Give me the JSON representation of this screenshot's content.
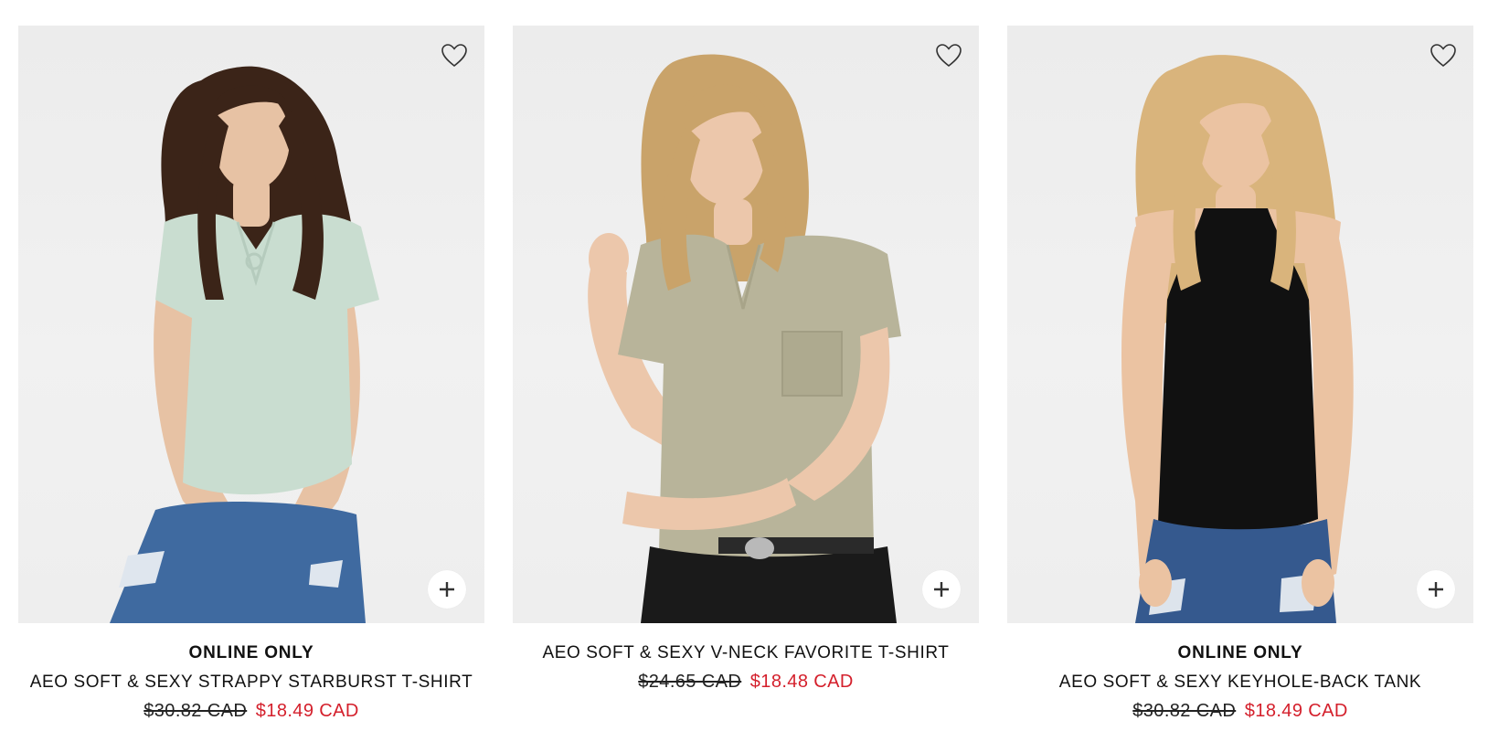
{
  "products": [
    {
      "badge": "ONLINE ONLY",
      "name": "AEO SOFT & SEXY STRAPPY STARBURST T-SHIRT",
      "old_price": "$30.82 CAD",
      "sale_price": "$18.49 CAD",
      "image": {
        "hair": "#3b2418",
        "top": "#c9ddd0",
        "bottom": "#3f6aa0",
        "skin": "#e7c2a4"
      }
    },
    {
      "badge": "",
      "name": "AEO SOFT & SEXY V-NECK FAVORITE T-SHIRT",
      "old_price": "$24.65 CAD",
      "sale_price": "$18.48 CAD",
      "image": {
        "hair": "#c9a36a",
        "top": "#b8b49a",
        "bottom": "#1a1a1a",
        "skin": "#ecc7ab"
      }
    },
    {
      "badge": "ONLINE ONLY",
      "name": "AEO SOFT & SEXY KEYHOLE-BACK TANK",
      "old_price": "$30.82 CAD",
      "sale_price": "$18.49 CAD",
      "image": {
        "hair": "#d9b47c",
        "top": "#111111",
        "bottom": "#35598e",
        "skin": "#ebc3a2"
      }
    }
  ],
  "icons": {
    "favorite": "heart-outline-icon",
    "quick_add": "plus-icon"
  },
  "colors": {
    "sale": "#d4202c",
    "text": "#111111",
    "image_bg": "#efefef"
  }
}
